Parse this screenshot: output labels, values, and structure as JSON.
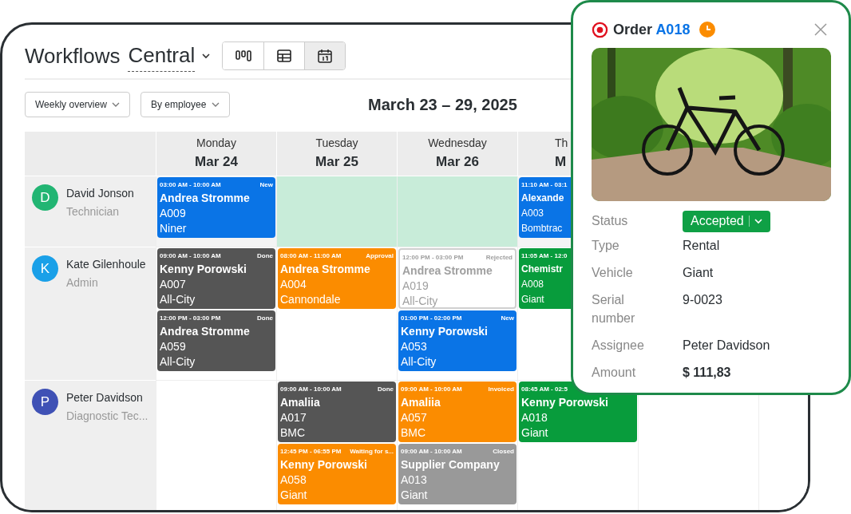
{
  "header": {
    "title_word": "Workflows",
    "workspace": "Central",
    "views": [
      {
        "kind": "board",
        "selected": false
      },
      {
        "kind": "table",
        "selected": false
      },
      {
        "kind": "calendar",
        "selected": true
      }
    ]
  },
  "filters": [
    {
      "label": "Weekly overview"
    },
    {
      "label": "By employee"
    }
  ],
  "date_range": "March 23 – 29, 2025",
  "days": [
    {
      "weekday": "Monday",
      "date": "Mar 24"
    },
    {
      "weekday": "Tuesday",
      "date": "Mar 25"
    },
    {
      "weekday": "Wednesday",
      "date": "Mar 26"
    },
    {
      "weekday": "Th",
      "date": "M"
    }
  ],
  "employees": [
    {
      "initial": "D",
      "name": "David Jonson",
      "role": "Technician",
      "color": "#22b573",
      "cells": [
        {
          "highlighted": false,
          "events": [
            {
              "time": "03:00 AM - 10:00 AM",
              "status": "New",
              "customer": "Andrea Stromme",
              "code": "A009",
              "vehicle": "Niner",
              "color": "#0a74e6",
              "disabled": false
            }
          ]
        },
        {
          "highlighted": true
        },
        {
          "highlighted": true
        },
        {
          "highlighted": false,
          "events": [
            {
              "time": "11:10 AM - 03:1",
              "customer": "Alexande",
              "code": "A003",
              "vehicle": "Bombtrac",
              "color": "#0a74e6",
              "disabled": false
            }
          ]
        }
      ]
    },
    {
      "initial": "K",
      "name": "Kate Gilenhoule",
      "role": "Admin",
      "color": "#1aa0e8",
      "cells": [
        {
          "highlighted": false,
          "events": [
            {
              "time": "09:00 AM - 10:00 AM",
              "status": "Done",
              "customer": "Kenny Porowski",
              "code": "A007",
              "vehicle": "All-City",
              "color": "#555555",
              "disabled": false
            },
            {
              "time": "12:00 PM - 03:00 PM",
              "status": "Done",
              "customer": "Andrea Stromme",
              "code": "A059",
              "vehicle": "All-City",
              "color": "#555555",
              "disabled": false
            }
          ]
        },
        {
          "highlighted": false,
          "events": [
            {
              "time": "08:00 AM - 11:00 AM",
              "status": "Approval",
              "customer": "Andrea Stromme",
              "code": "A004",
              "vehicle": "Cannondale",
              "color": "#fb8c00",
              "disabled": false
            }
          ]
        },
        {
          "highlighted": false,
          "events": [
            {
              "time": "12:00 PM - 03:00 PM",
              "status": "Rejected",
              "customer": "Andrea Stromme",
              "code": "A019",
              "vehicle": "All-City",
              "color": "#d0d0d0",
              "disabled": true
            },
            {
              "time": "01:00 PM - 02:00 PM",
              "status": "New",
              "customer": "Kenny Porowski",
              "code": "A053",
              "vehicle": "All-City",
              "color": "#0a74e6",
              "disabled": false
            }
          ]
        },
        {
          "highlighted": false,
          "events": [
            {
              "time": "11:05 AM - 12:0",
              "customer": "Chemistr",
              "code": "A008",
              "vehicle": "Giant",
              "color": "#089c3c",
              "disabled": false
            }
          ]
        }
      ]
    },
    {
      "initial": "P",
      "name": "Peter Davidson",
      "role": "Diagnostic Tec...",
      "color": "#3f51b5",
      "cells": [
        {
          "highlighted": false
        },
        {
          "highlighted": false,
          "events": [
            {
              "time": "09:00 AM - 10:00 AM",
              "status": "Done",
              "customer": "Amaliia",
              "code": "A017",
              "vehicle": "BMC",
              "color": "#555555",
              "disabled": false
            },
            {
              "time": "12:45 PM - 06:55 PM",
              "status": "Waiting for s...",
              "customer": "Kenny Porowski",
              "code": "A058",
              "vehicle": "Giant",
              "color": "#fb8c00",
              "disabled": false
            }
          ]
        },
        {
          "highlighted": false,
          "events": [
            {
              "time": "09:00 AM - 10:00 AM",
              "status": "Invoiced",
              "customer": "Amaliia",
              "code": "A057",
              "vehicle": "BMC",
              "color": "#fb8c00",
              "disabled": false
            },
            {
              "time": "09:00 AM - 10:00 AM",
              "status": "Closed",
              "customer": "Supplier Company",
              "code": "A013",
              "vehicle": "Giant",
              "color": "#999999",
              "disabled": false
            }
          ]
        },
        {
          "highlighted": false,
          "events": [
            {
              "time": "08:45 AM - 02:5",
              "customer": "Kenny Porowski",
              "code": "A018",
              "vehicle": "Giant",
              "color": "#089c3c",
              "disabled": false
            }
          ]
        },
        {
          "highlighted": false
        },
        {
          "highlighted": false
        }
      ]
    }
  ],
  "popup": {
    "title": "Order",
    "code": "A018",
    "status": {
      "label": "Status",
      "value": "Accepted"
    },
    "fields": [
      {
        "label": "Type",
        "value": "Rental"
      },
      {
        "label": "Vehicle",
        "value": "Giant"
      },
      {
        "label": "Serial number",
        "value": "9-0023"
      },
      {
        "label": "Assignee",
        "value": "Peter Davidson"
      },
      {
        "label": "Amount",
        "value": "$ 111,83",
        "kind": "amount"
      }
    ]
  }
}
